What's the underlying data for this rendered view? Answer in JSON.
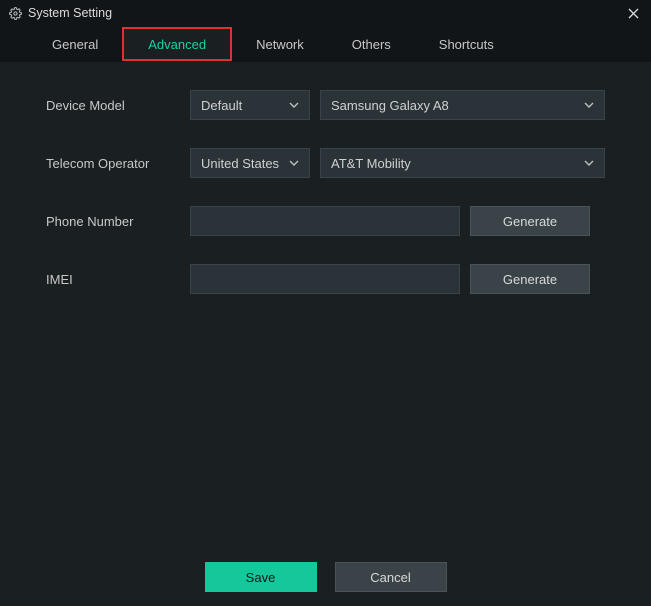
{
  "window": {
    "title": "System Setting"
  },
  "tabs": {
    "general": "General",
    "advanced": "Advanced",
    "network": "Network",
    "others": "Others",
    "shortcuts": "Shortcuts"
  },
  "fields": {
    "device_model": {
      "label": "Device Model",
      "brand": "Default",
      "model": "Samsung Galaxy A8"
    },
    "telecom_operator": {
      "label": "Telecom Operator",
      "country": "United States",
      "operator": "AT&T Mobility"
    },
    "phone_number": {
      "label": "Phone Number",
      "value": "",
      "button": "Generate"
    },
    "imei": {
      "label": "IMEI",
      "value": "",
      "button": "Generate"
    }
  },
  "footer": {
    "save": "Save",
    "cancel": "Cancel"
  }
}
